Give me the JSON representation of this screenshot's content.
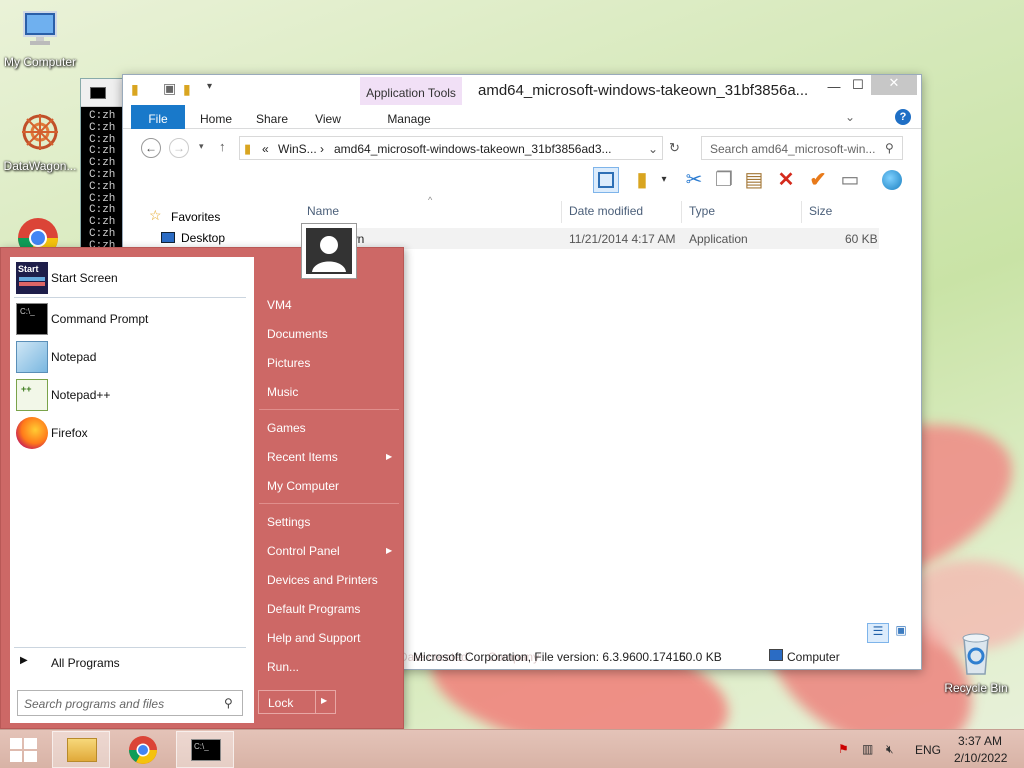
{
  "desktop": {
    "icons": [
      {
        "label": "My Computer",
        "icon": "computer-icon"
      },
      {
        "label": "DataWagon...",
        "icon": "datawagon-icon"
      },
      {
        "label": "Recycle Bin",
        "icon": "recycle-bin-icon"
      }
    ]
  },
  "console": {
    "lines": [
      "C:zh",
      "C:zh",
      "C:zh",
      "C:zh",
      "C:zh",
      "C:zh",
      "C:zh",
      "C:zh",
      "C:zh",
      "C:zh",
      "C:zh",
      "C:zh"
    ]
  },
  "explorer": {
    "title": "amd64_microsoft-windows-takeown_31bf3856a...",
    "app_tools": "Application Tools",
    "tabs": [
      "File",
      "Home",
      "Share",
      "View",
      "Manage"
    ],
    "address": {
      "prefix": "«",
      "part1": "WinS...",
      "sep": "›",
      "part2": "amd64_microsoft-windows-takeown_31bf3856ad3..."
    },
    "search_placeholder": "Search amd64_microsoft-win...",
    "nav": {
      "favorites": "Favorites",
      "desktop": "Desktop"
    },
    "columns": {
      "name": "Name",
      "date": "Date modified",
      "type": "Type",
      "size": "Size"
    },
    "files": [
      {
        "name": "takeown",
        "name_visible": "wn",
        "date": "11/21/2014 4:17 AM",
        "type": "Application",
        "size": "60 KB"
      }
    ],
    "status": {
      "faded": "Date created: ... Company:",
      "details": "Microsoft Corporation, File version: 6.3.9600.17415",
      "size": "60.0 KB",
      "location": "Computer"
    }
  },
  "startmenu": {
    "pinned": [
      {
        "label": "Start Screen",
        "icon": "start-screen-icon"
      },
      {
        "label": "Command Prompt",
        "icon": "command-prompt-icon"
      },
      {
        "label": "Notepad",
        "icon": "notepad-icon"
      },
      {
        "label": "Notepad++",
        "icon": "notepadpp-icon"
      },
      {
        "label": "Firefox",
        "icon": "firefox-icon"
      }
    ],
    "all_programs": "All Programs",
    "search_placeholder": "Search programs and files",
    "right": {
      "user": "VM4",
      "documents": "Documents",
      "pictures": "Pictures",
      "music": "Music",
      "games": "Games",
      "recent": "Recent Items",
      "computer": "My Computer",
      "settings": "Settings",
      "control_panel": "Control Panel",
      "devices": "Devices and Printers",
      "defaults": "Default Programs",
      "help": "Help and Support",
      "run": "Run..."
    },
    "lock": "Lock"
  },
  "taskbar": {
    "lang": "ENG",
    "time": "3:37 AM",
    "date": "2/10/2022"
  },
  "colors": {
    "startmenu_bg": "#cd6866",
    "file_tab": "#1979ca",
    "app_tools_bg": "#f1e0f6"
  }
}
